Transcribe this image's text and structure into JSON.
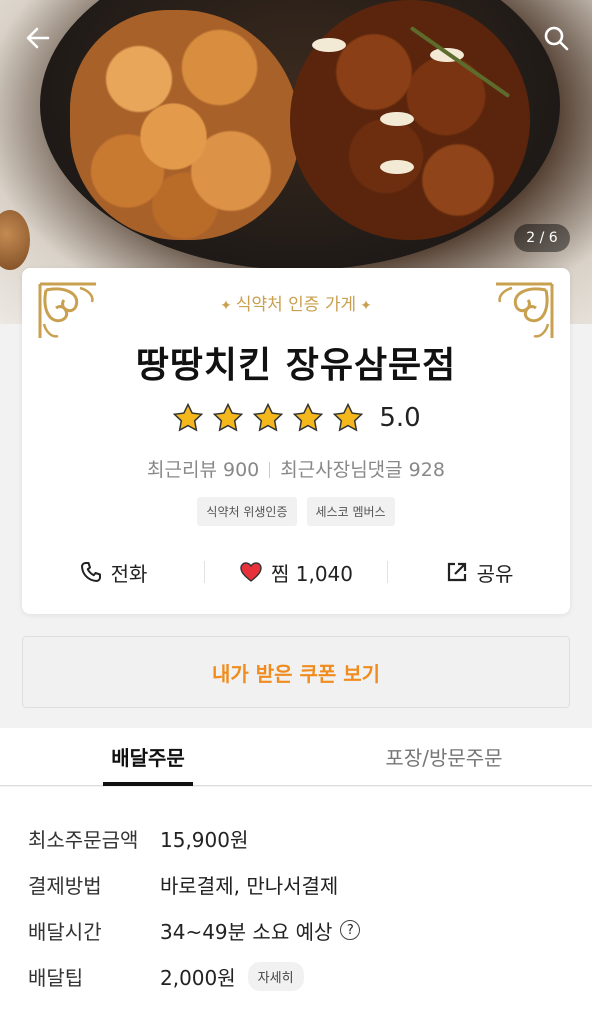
{
  "hero": {
    "counter": "2 / 6"
  },
  "store": {
    "certification": "식약처 인증 가게",
    "name": "땅땅치킨 장유삼문점",
    "rating": "5.0",
    "rating_stars": 5,
    "recent_reviews": "최근리뷰 900",
    "owner_replies": "최근사장님댓글 928",
    "badges": [
      "식약처 위생인증",
      "세스코 멤버스"
    ],
    "actions": {
      "call": "전화",
      "like": "찜 1,040",
      "share": "공유"
    }
  },
  "coupon": {
    "label": "내가 받은 쿠폰 보기"
  },
  "tabs": [
    {
      "label": "배달주문",
      "active": true
    },
    {
      "label": "포장/방문주문",
      "active": false
    }
  ],
  "info": {
    "min_order": {
      "label": "최소주문금액",
      "value": "15,900원"
    },
    "payment": {
      "label": "결제방법",
      "value": "바로결제, 만나서결제"
    },
    "delivery_time": {
      "label": "배달시간",
      "value": "34~49분 소요 예상"
    },
    "delivery_tip": {
      "label": "배달팁",
      "value": "2,000원",
      "detail": "자세히"
    }
  },
  "colors": {
    "accent": "#f08c1e",
    "gold": "#c9a04f",
    "star": "#f5b81c",
    "heart": "#e8303a"
  }
}
